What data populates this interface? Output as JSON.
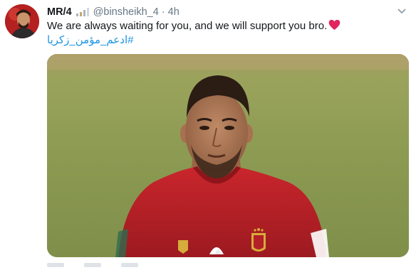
{
  "tweet": {
    "author": {
      "display_name": "MR/4",
      "handle": "@binsheikh_4",
      "avatar": "avatar-photo"
    },
    "separator": "·",
    "timestamp": "4h",
    "text": "We are always waiting for you, and we will support you bro.",
    "text_emoji": "red-heart-icon",
    "hashtag": "#ادعم_مؤمن_زكريا",
    "hashtag_color": "#1b95e0",
    "media": {
      "type": "photo",
      "description_icon": "football-player-photo"
    },
    "more_icon": "chevron-down-icon"
  },
  "colors": {
    "name": "#14171a",
    "meta": "#657786",
    "link": "#1b95e0",
    "heart": "#e0245e",
    "jersey": "#c0262d"
  }
}
